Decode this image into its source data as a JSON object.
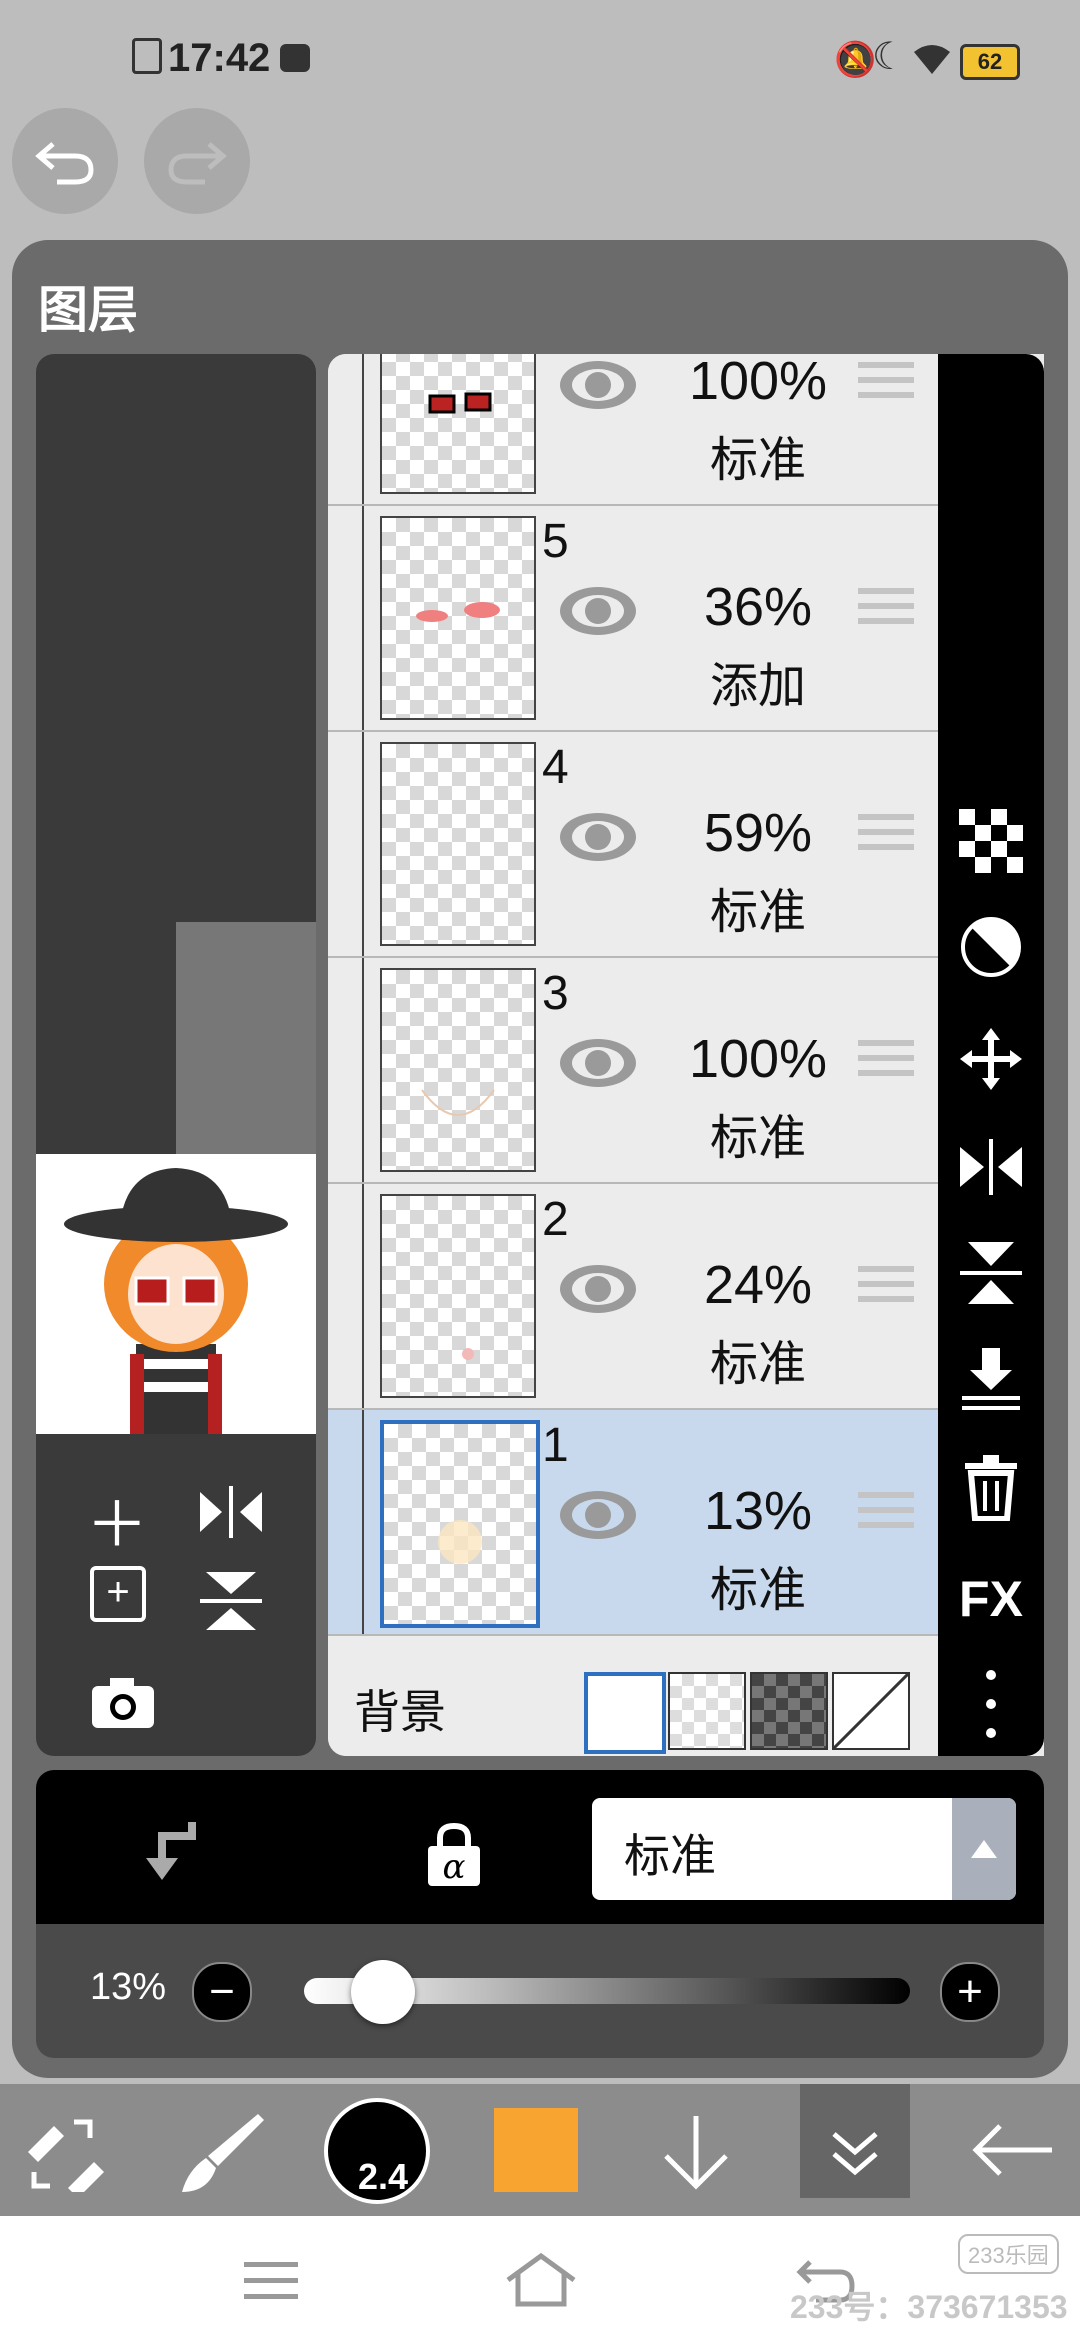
{
  "status_bar": {
    "time": "17:42",
    "battery": "62"
  },
  "panel": {
    "title": "图层"
  },
  "layers": [
    {
      "number": "",
      "opacity": "100%",
      "blend": "标准",
      "selected": false
    },
    {
      "number": "5",
      "opacity": "36%",
      "blend": "添加",
      "selected": false
    },
    {
      "number": "4",
      "opacity": "59%",
      "blend": "标准",
      "selected": false
    },
    {
      "number": "3",
      "opacity": "100%",
      "blend": "标准",
      "selected": false
    },
    {
      "number": "2",
      "opacity": "24%",
      "blend": "标准",
      "selected": false
    },
    {
      "number": "1",
      "opacity": "13%",
      "blend": "标准",
      "selected": true
    }
  ],
  "background": {
    "label": "背景"
  },
  "side_tools": {
    "fx_label": "FX"
  },
  "blend_select": {
    "value": "标准"
  },
  "opacity_slider": {
    "label": "13%",
    "value": 0.13
  },
  "toolbar": {
    "brush_size": "2.4",
    "color": "#f7a530"
  },
  "watermark": {
    "logo": "233乐园",
    "text": "233号：373671353"
  }
}
